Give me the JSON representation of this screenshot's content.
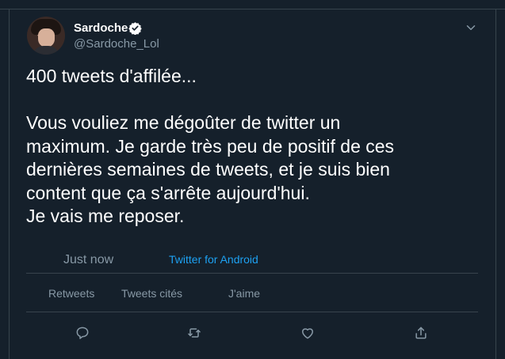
{
  "tweet": {
    "author": {
      "display_name": "Sardoche",
      "handle": "@Sardoche_Lol",
      "verified": true
    },
    "text_lines": [
      "400 tweets d'affilée...",
      "",
      "Vous vouliez me dégoûter de twitter un",
      "maximum. Je garde très peu de positif de ces",
      "dernières semaines de tweets, et je suis bien",
      "content que ça s'arrête aujourd'hui.",
      "Je vais me reposer."
    ],
    "timestamp": "Just now",
    "source": "Twitter for Android"
  },
  "stats": {
    "retweets_label": "Retweets",
    "quotes_label": "Tweets cités",
    "likes_label": "J'aime"
  },
  "actions": [
    {
      "icon": "reply-icon"
    },
    {
      "icon": "retweet-icon"
    },
    {
      "icon": "like-icon"
    },
    {
      "icon": "share-icon"
    }
  ],
  "colors": {
    "background": "#15202b",
    "border": "#38444d",
    "secondary_text": "#8899a6",
    "accent": "#1da1f2",
    "primary_text": "#ffffff"
  }
}
